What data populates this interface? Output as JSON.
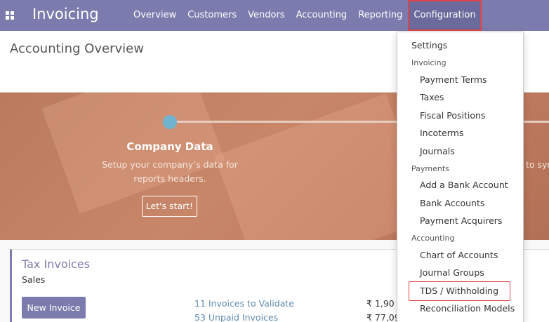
{
  "navbar": {
    "brand": "Invoicing",
    "menu": [
      "Overview",
      "Customers",
      "Vendors",
      "Accounting",
      "Reporting",
      "Configuration"
    ]
  },
  "page": {
    "title": "Accounting Overview"
  },
  "onboarding": {
    "step1_title": "Company Data",
    "step1_desc_line1": "Setup your company’s data for",
    "step1_desc_line2": "reports headers.",
    "step1_button": "Let's start!",
    "step2_title_partial": "t",
    "step2_desc_partial": "to syn"
  },
  "journal_card": {
    "title": "Tax Invoices",
    "subtitle": "Sales",
    "new_button": "New Invoice",
    "stats": [
      {
        "label": "11 Invoices to Validate",
        "amount": "₹ 1,90"
      },
      {
        "label": "53 Unpaid Invoices",
        "amount": "₹ 77,09"
      }
    ]
  },
  "config_dropdown": {
    "settings": "Settings",
    "sections": [
      {
        "header": "Invoicing",
        "items": [
          "Payment Terms",
          "Taxes",
          "Fiscal Positions",
          "Incoterms",
          "Journals"
        ]
      },
      {
        "header": "Payments",
        "items": [
          "Add a Bank Account",
          "Bank Accounts",
          "Payment Acquirers"
        ]
      },
      {
        "header": "Accounting",
        "items": [
          "Chart of Accounts",
          "Journal Groups",
          "TDS / Withholding",
          "Reconciliation Models"
        ]
      }
    ]
  },
  "colors": {
    "brand": "#7c7bad",
    "highlight": "#e04545",
    "banner": "#c88669"
  }
}
